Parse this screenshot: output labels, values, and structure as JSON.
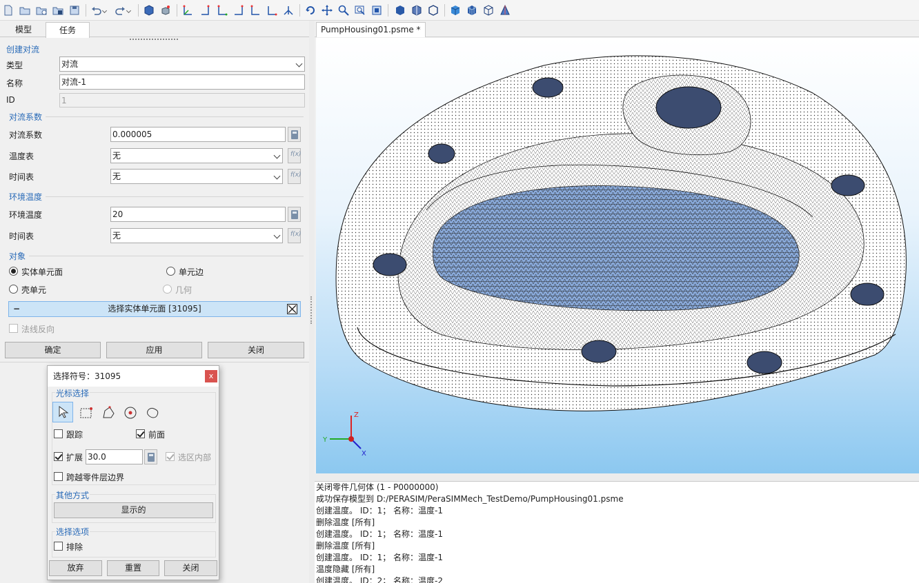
{
  "toolbar": {
    "icons": [
      "new-icon",
      "open-icon",
      "open-recent-icon",
      "import-icon",
      "save-icon",
      "undo-icon",
      "redo-icon",
      "view-cube-icon",
      "view-iso-icon",
      "view-front-icon",
      "view-back-icon",
      "view-left-icon",
      "view-right-icon",
      "view-top-icon",
      "view-bottom-icon",
      "view-axis-icon",
      "rotate-icon",
      "pan-icon",
      "zoom-icon",
      "zoom-window-icon",
      "fit-icon",
      "shaded-icon",
      "wire-icon",
      "outline-icon",
      "solid-icon",
      "mesh-icon",
      "wireframe-icon",
      "perspective-icon"
    ]
  },
  "left_panel": {
    "tabs": [
      "模型",
      "任务"
    ],
    "active_tab": "任务",
    "section_create": "创建对流",
    "type_label": "类型",
    "type_value": "对流",
    "name_label": "名称",
    "name_value": "对流-1",
    "id_label": "ID",
    "id_value": "1",
    "section_coeff": "对流系数",
    "coeff_label": "对流系数",
    "coeff_value": "0.000005",
    "temp_table_label": "温度表",
    "temp_table_value": "无",
    "time_table_label": "时间表",
    "time_table_value": "无",
    "section_ambient": "环境温度",
    "ambient_label": "环境温度",
    "ambient_value": "20",
    "ambient_time_label": "时间表",
    "ambient_time_value": "无",
    "section_object": "对象",
    "radio_solid_face": "实体单元面",
    "radio_elem_edge": "单元边",
    "radio_shell": "壳单元",
    "radio_geometry": "几何",
    "select_bar_text": "选择实体单元面 [31095]",
    "select_bar_minus": "−",
    "flip_normal": "法线反向",
    "ok": "确定",
    "apply": "应用",
    "close": "关闭"
  },
  "document": {
    "tab_title": "PumpHousing01.psme *"
  },
  "triad": {
    "x": "X",
    "y": "Y",
    "z": "Z"
  },
  "console": {
    "lines": [
      "关闭零件几何体 (1 - P0000000)",
      "成功保存模型到 D:/PERASIM/PeraSIMMech_TestDemo/PumpHousing01.psme",
      "创建温度。 ID：1；  名称：温度-1",
      "删除温度 [所有]",
      "创建温度。 ID：1；  名称：温度-1",
      "删除温度 [所有]",
      "创建温度。 ID：1；  名称：温度-1",
      "温度隐藏 [所有]",
      "创建温度。 ID：2；  名称：温度-2"
    ]
  },
  "dialog": {
    "title": "选择符号：31095",
    "close": "x",
    "cursor_group": "光标选择",
    "track": "跟踪",
    "front": "前面",
    "expand": "扩展",
    "expand_value": "30.0",
    "inside": "选区内部",
    "cross_boundary": "跨越零件层边界",
    "other_group": "其他方式",
    "shown": "显示的",
    "options_group": "选择选项",
    "exclude": "排除",
    "discard": "放弃",
    "reset": "重置",
    "close_btn": "关闭"
  }
}
